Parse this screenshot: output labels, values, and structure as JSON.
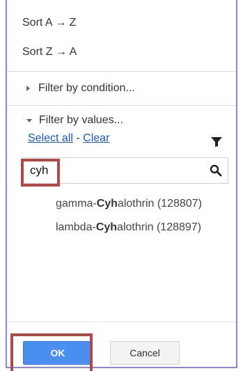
{
  "menu": {
    "sort_az": "Sort A → Z",
    "sort_za": "Sort Z → A",
    "filter_by_condition": "Filter by condition...",
    "filter_by_values": "Filter by values..."
  },
  "filter_values": {
    "select_all": "Select all",
    "separator": "-",
    "clear": "Clear",
    "search": {
      "value": "cyh",
      "placeholder": ""
    },
    "items": [
      {
        "prefix": "gamma-",
        "match": "Cyh",
        "suffix": "alothrin (128807)"
      },
      {
        "prefix": "lambda-",
        "match": "Cyh",
        "suffix": "alothrin (128897)"
      }
    ]
  },
  "footer": {
    "ok_label": "OK",
    "cancel_label": "Cancel"
  },
  "colors": {
    "panel_border": "#8a84e8",
    "link": "#1a56c8",
    "ok_button": "#4a8ff0",
    "highlight": "#b14848"
  },
  "icons": {
    "filter": "filter-funnel-icon",
    "search": "search-icon",
    "collapsed": "caret-right-icon",
    "expanded": "caret-down-icon"
  }
}
